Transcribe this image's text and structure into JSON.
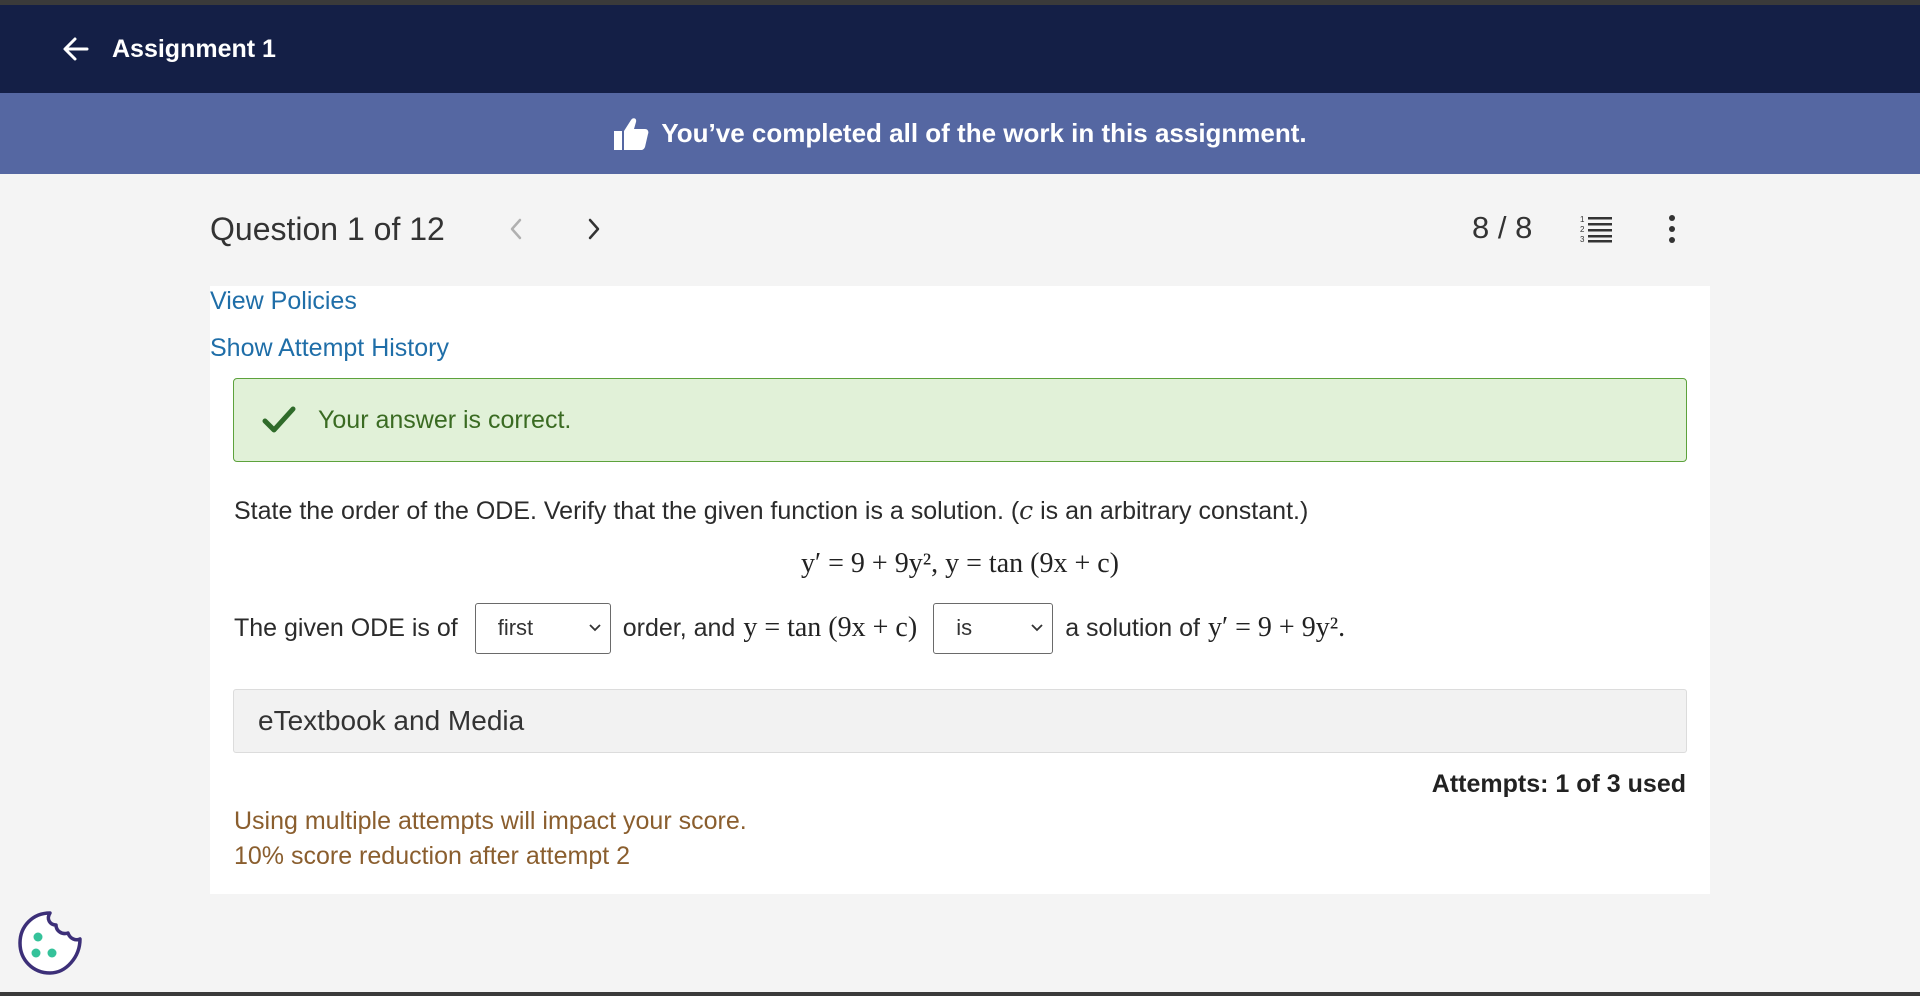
{
  "header": {
    "title": "Assignment 1",
    "back_icon": "arrow-left-icon"
  },
  "banner": {
    "icon": "thumbs-up-icon",
    "text": "You’ve completed all of the work in this assignment."
  },
  "question_nav": {
    "title": "Question 1 of 12",
    "score": "8 / 8"
  },
  "links": {
    "view_policies": "View Policies",
    "show_history": "Show Attempt History"
  },
  "feedback": {
    "text": "Your answer is correct."
  },
  "question": {
    "prompt_before": "State the order of the ODE. Verify that the given function is a solution. (",
    "prompt_var": "c",
    "prompt_after": " is an arbitrary constant.)",
    "equation": "y′ = 9 + 9y², y = tan (9x + c)",
    "answer_prefix": "The given ODE is of",
    "order_select_value": "first",
    "answer_mid": "order, and",
    "answer_mid_math": "y = tan (9x + c)",
    "solution_select_value": "is",
    "answer_suffix": "a solution of",
    "answer_suffix_math": "y′ = 9 + 9y²."
  },
  "resources": {
    "label": "eTextbook and Media"
  },
  "attempts": {
    "text": "Attempts: 1 of 3 used"
  },
  "penalty": {
    "line1": "Using multiple attempts will impact your score.",
    "line2": "10% score reduction after attempt 2"
  },
  "colors": {
    "header_bg": "#141f46",
    "banner_bg": "#5567a2",
    "link": "#1f6ea8",
    "success_bg": "#e1f1d8",
    "success_border": "#5da23c",
    "penalty_text": "#8a5e2e"
  }
}
